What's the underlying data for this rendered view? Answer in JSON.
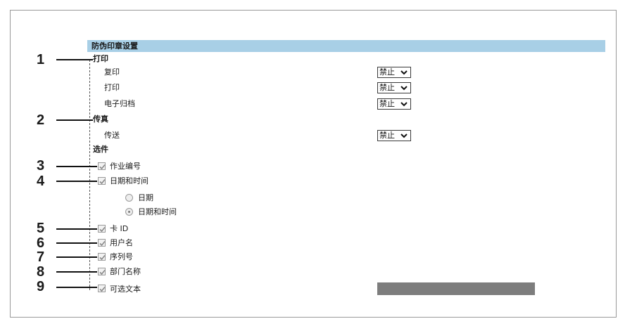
{
  "header": {
    "title": "防伪印章设置"
  },
  "print_section": {
    "label": "打印",
    "rows": [
      {
        "label": "复印",
        "value": "禁止"
      },
      {
        "label": "打印",
        "value": "禁止"
      },
      {
        "label": "电子归档",
        "value": "禁止"
      }
    ]
  },
  "fax_section": {
    "label": "传真",
    "rows": [
      {
        "label": "传送",
        "value": "禁止"
      }
    ]
  },
  "options_section": {
    "label": "选件",
    "job_number": "作业编号",
    "date_time": "日期和时间",
    "radio_date": "日期",
    "radio_date_time": "日期和时间",
    "card_id": "卡 ID",
    "user_name": "用户名",
    "serial_number": "序列号",
    "department_name": "部门名称",
    "optional_text": "可选文本"
  },
  "callouts": [
    "1",
    "2",
    "3",
    "4",
    "5",
    "6",
    "7",
    "8",
    "9"
  ]
}
